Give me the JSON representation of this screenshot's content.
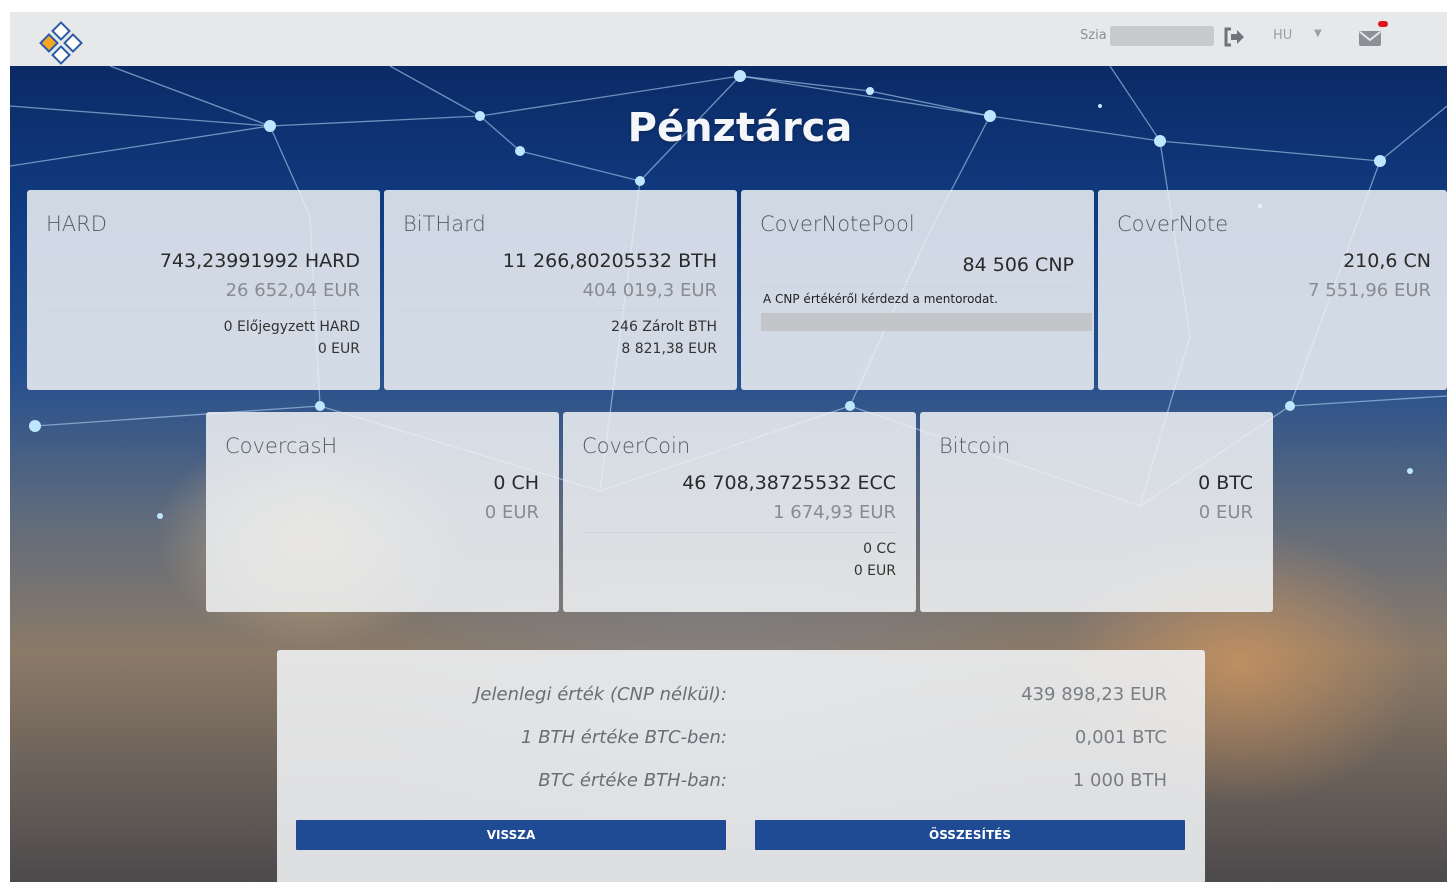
{
  "header": {
    "greeting": "Szia",
    "language": "HU",
    "colors": {
      "bar": "#e7e8ea",
      "logo_orange": "#f5a623",
      "logo_blue": "#2a5aa6",
      "notification": "#e0141e"
    },
    "icons": [
      "logo-icon",
      "logout-icon",
      "chevron-down-icon",
      "mail-icon"
    ]
  },
  "page": {
    "title": "Pénztárca"
  },
  "cards": [
    {
      "name": "HARD",
      "amount": "743,23991992 HARD",
      "eur": "26 652,04 EUR",
      "sub1": "0 Előjegyzett HARD",
      "sub2": "0 EUR"
    },
    {
      "name": "BiTHard",
      "amount": "11 266,80205532 BTH",
      "eur": "404 019,3 EUR",
      "sub1": "246 Zárolt BTH",
      "sub2": "8 821,38 EUR"
    },
    {
      "name": "CoverNotePool",
      "amount": "84 506 CNP",
      "note": "A CNP értékéről kérdezd a mentorodat."
    },
    {
      "name": "CoverNote",
      "amount": "210,6 CN",
      "eur": "7 551,96 EUR"
    },
    {
      "name": "CovercasH",
      "amount": "0 CH",
      "eur": "0 EUR"
    },
    {
      "name": "CoverCoin",
      "amount": "46 708,38725532 ECC",
      "eur": "1 674,93 EUR",
      "sub1": "0 CC",
      "sub2": "0 EUR"
    },
    {
      "name": "Bitcoin",
      "amount": "0 BTC",
      "eur": "0 EUR"
    }
  ],
  "summary": {
    "rows": [
      {
        "label": "Jelenlegi érték (CNP nélkül):",
        "value": "439 898,23 EUR"
      },
      {
        "label": "1 BTH értéke BTC-ben:",
        "value": "0,001 BTC"
      },
      {
        "label": "BTC értéke BTH-ban:",
        "value": "1 000 BTH"
      }
    ],
    "back_button": "VISSZA",
    "total_button": "ÖSSZESÍTÉS",
    "button_color": "#1e4b94"
  }
}
